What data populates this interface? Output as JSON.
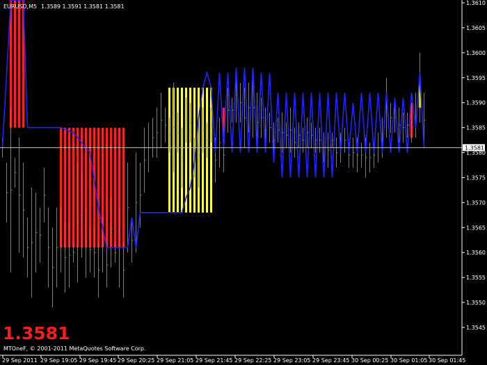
{
  "header": {
    "symbol": "EURUSD,M5",
    "ohlc": "1.3589 1.3591 1.3581 1.3581"
  },
  "current_price_label": "1.3581",
  "big_price": "1.3581",
  "copyright": "MTOneF, © 2001-2011 MetaQuotes Software Corp.",
  "colors": {
    "background": "#000000",
    "bar_up": "#1db954",
    "bar_down": "#1db954",
    "line": "#2222ff",
    "fill_bear": "#ff2020",
    "fill_bull": "#ffff40",
    "grid": "#ffffff",
    "price_line": "#c0c0c0",
    "big_price": "#ff1a1a"
  },
  "chart_data": {
    "type": "line",
    "ylim": [
      1.3543,
      1.3611
    ],
    "yticks": [
      "1.3610",
      "1.3605",
      "1.3600",
      "1.3595",
      "1.3590",
      "1.3585",
      "1.3580",
      "1.3575",
      "1.3570",
      "1.3565",
      "1.3560",
      "1.3555",
      "1.3550",
      "1.3545"
    ],
    "xticks": [
      "29 Sep 2011",
      "29 Sep 19:05",
      "29 Sep 19:45",
      "29 Sep 20:25",
      "29 Sep 21:05",
      "29 Sep 21:45",
      "29 Sep 22:25",
      "29 Sep 23:05",
      "29 Sep 23:45",
      "30 Sep 00:25",
      "30 Sep 01:05",
      "30 Sep 01:45"
    ],
    "current_price": 1.3581,
    "bars": [
      [
        1.3583,
        1.3579
      ],
      [
        1.3578,
        1.3566
      ],
      [
        1.3589,
        1.3556
      ],
      [
        1.3579,
        1.3573
      ],
      [
        1.3583,
        1.356
      ],
      [
        1.3578,
        1.3559
      ],
      [
        1.3567,
        1.3555
      ],
      [
        1.3573,
        1.3551
      ],
      [
        1.3572,
        1.3556
      ],
      [
        1.3569,
        1.3558
      ],
      [
        1.3577,
        1.3566
      ],
      [
        1.3569,
        1.3553
      ],
      [
        1.3565,
        1.3549
      ],
      [
        1.3569,
        1.3553
      ],
      [
        1.3569,
        1.3556
      ],
      [
        1.3566,
        1.3552
      ],
      [
        1.3566,
        1.3553
      ],
      [
        1.3562,
        1.3558
      ],
      [
        1.3578,
        1.3554
      ],
      [
        1.3576,
        1.3559
      ],
      [
        1.3569,
        1.3555
      ],
      [
        1.3565,
        1.3556
      ],
      [
        1.3565,
        1.3555
      ],
      [
        1.3562,
        1.3551
      ],
      [
        1.3567,
        1.3556
      ],
      [
        1.3562,
        1.3553
      ],
      [
        1.3571,
        1.3557
      ],
      [
        1.3562,
        1.3558
      ],
      [
        1.3569,
        1.3553
      ],
      [
        1.3562,
        1.3551
      ],
      [
        1.3578,
        1.356
      ],
      [
        1.3567,
        1.3558
      ],
      [
        1.358,
        1.356
      ],
      [
        1.3578,
        1.3565
      ],
      [
        1.3585,
        1.3572
      ],
      [
        1.3586,
        1.3576
      ],
      [
        1.3587,
        1.3579
      ],
      [
        1.3589,
        1.3579
      ],
      [
        1.3592,
        1.3581
      ],
      [
        1.3589,
        1.3582
      ],
      [
        1.3587,
        1.358
      ],
      [
        1.3594,
        1.3576
      ],
      [
        1.3588,
        1.358
      ],
      [
        1.3585,
        1.3573
      ],
      [
        1.3591,
        1.3582
      ],
      [
        1.359,
        1.3582
      ],
      [
        1.3583,
        1.3575
      ],
      [
        1.3586,
        1.3573
      ],
      [
        1.3589,
        1.358
      ],
      [
        1.3586,
        1.3579
      ],
      [
        1.3589,
        1.3582
      ],
      [
        1.3583,
        1.3574
      ],
      [
        1.3587,
        1.3577
      ],
      [
        1.3583,
        1.3576
      ],
      [
        1.3593,
        1.3584
      ],
      [
        1.3591,
        1.3586
      ],
      [
        1.3597,
        1.3586
      ],
      [
        1.3594,
        1.3586
      ],
      [
        1.3593,
        1.3581
      ],
      [
        1.3594,
        1.3584
      ],
      [
        1.3595,
        1.3583
      ],
      [
        1.3592,
        1.358
      ],
      [
        1.3591,
        1.3583
      ],
      [
        1.3589,
        1.358
      ],
      [
        1.3588,
        1.3582
      ],
      [
        1.3586,
        1.3579
      ],
      [
        1.3587,
        1.3582
      ],
      [
        1.3588,
        1.358
      ],
      [
        1.3586,
        1.3581
      ],
      [
        1.3589,
        1.358
      ],
      [
        1.3585,
        1.3579
      ],
      [
        1.3586,
        1.3581
      ],
      [
        1.3585,
        1.358
      ],
      [
        1.3587,
        1.3581
      ],
      [
        1.3586,
        1.3581
      ],
      [
        1.3585,
        1.358
      ],
      [
        1.3585,
        1.358
      ],
      [
        1.3584,
        1.3578
      ],
      [
        1.3584,
        1.3577
      ],
      [
        1.3584,
        1.3581
      ],
      [
        1.3583,
        1.3577
      ],
      [
        1.3584,
        1.3578
      ],
      [
        1.3585,
        1.358
      ],
      [
        1.3582,
        1.3577
      ],
      [
        1.3583,
        1.3577
      ],
      [
        1.3583,
        1.3576
      ],
      [
        1.3582,
        1.3577
      ],
      [
        1.3583,
        1.3575
      ],
      [
        1.3582,
        1.3576
      ],
      [
        1.3582,
        1.3577
      ],
      [
        1.3584,
        1.3578
      ],
      [
        1.3587,
        1.3579
      ],
      [
        1.3595,
        1.3583
      ],
      [
        1.359,
        1.3584
      ],
      [
        1.359,
        1.3584
      ],
      [
        1.3589,
        1.3582
      ],
      [
        1.3588,
        1.3582
      ],
      [
        1.3588,
        1.3583
      ],
      [
        1.359,
        1.3582
      ],
      [
        1.3592,
        1.3583
      ],
      [
        1.36,
        1.3586
      ],
      [
        1.3592,
        1.3581
      ]
    ],
    "line": [
      [
        0,
        1.3581
      ],
      [
        2,
        1.3611
      ],
      [
        3,
        1.3611
      ],
      [
        5,
        1.3611
      ],
      [
        6,
        1.3585
      ],
      [
        8,
        1.3585
      ],
      [
        14,
        1.3585
      ],
      [
        17,
        1.3584
      ],
      [
        21,
        1.358
      ],
      [
        23,
        1.3569
      ],
      [
        25,
        1.3561
      ],
      [
        27,
        1.3561
      ],
      [
        29,
        1.3561
      ],
      [
        30,
        1.3561
      ],
      [
        31,
        1.3567
      ],
      [
        32,
        1.3561
      ],
      [
        33,
        1.3568
      ],
      [
        35,
        1.3568
      ],
      [
        40,
        1.3568
      ],
      [
        42,
        1.3568
      ],
      [
        43,
        1.3568
      ],
      [
        44,
        1.3571
      ],
      [
        45,
        1.3573
      ],
      [
        46,
        1.3578
      ],
      [
        47,
        1.3587
      ],
      [
        48,
        1.3593
      ],
      [
        49,
        1.3596
      ],
      [
        50,
        1.3593
      ],
      [
        51,
        1.358
      ],
      [
        52,
        1.3596
      ],
      [
        53,
        1.3581
      ],
      [
        54,
        1.3596
      ],
      [
        55,
        1.358
      ],
      [
        56,
        1.3597
      ],
      [
        57,
        1.358
      ],
      [
        58,
        1.3597
      ],
      [
        59,
        1.358
      ],
      [
        60,
        1.3597
      ],
      [
        61,
        1.358
      ],
      [
        62,
        1.3596
      ],
      [
        63,
        1.358
      ],
      [
        64,
        1.3596
      ],
      [
        65,
        1.3578
      ],
      [
        66,
        1.3592
      ],
      [
        67,
        1.3575
      ],
      [
        68,
        1.3592
      ],
      [
        69,
        1.3575
      ],
      [
        70,
        1.3592
      ],
      [
        71,
        1.3575
      ],
      [
        72,
        1.3592
      ],
      [
        73,
        1.3575
      ],
      [
        74,
        1.3592
      ],
      [
        75,
        1.3575
      ],
      [
        76,
        1.3592
      ],
      [
        77,
        1.3575
      ],
      [
        78,
        1.3592
      ],
      [
        79,
        1.3575
      ],
      [
        80,
        1.3592
      ],
      [
        81,
        1.358
      ],
      [
        82,
        1.3592
      ],
      [
        83,
        1.358
      ],
      [
        84,
        1.359
      ],
      [
        85,
        1.358
      ],
      [
        86,
        1.3592
      ],
      [
        87,
        1.358
      ],
      [
        88,
        1.3592
      ],
      [
        89,
        1.358
      ],
      [
        90,
        1.3592
      ],
      [
        91,
        1.358
      ],
      [
        92,
        1.3592
      ],
      [
        93,
        1.358
      ],
      [
        94,
        1.3591
      ],
      [
        95,
        1.358
      ],
      [
        96,
        1.3591
      ],
      [
        97,
        1.358
      ],
      [
        98,
        1.3592
      ],
      [
        99,
        1.3585
      ],
      [
        100,
        1.3596
      ],
      [
        101,
        1.3581
      ]
    ],
    "fills": [
      {
        "from": 2,
        "to": 5,
        "top": 1.3611,
        "bottom": 1.3585,
        "type": "bear"
      },
      {
        "from": 14,
        "to": 29,
        "top": 1.3585,
        "bottom": 1.3561,
        "type": "bear"
      },
      {
        "from": 40,
        "to": 50,
        "top": 1.3593,
        "bottom": 1.3568,
        "type": "bull"
      },
      {
        "from": 53,
        "to": 53,
        "top": 1.3589,
        "bottom": 1.3582,
        "type": "bear"
      },
      {
        "from": 98,
        "to": 98,
        "top": 1.359,
        "bottom": 1.3583,
        "type": "bear"
      },
      {
        "from": 100,
        "to": 100,
        "top": 1.3594,
        "bottom": 1.3589,
        "type": "bull"
      }
    ]
  }
}
